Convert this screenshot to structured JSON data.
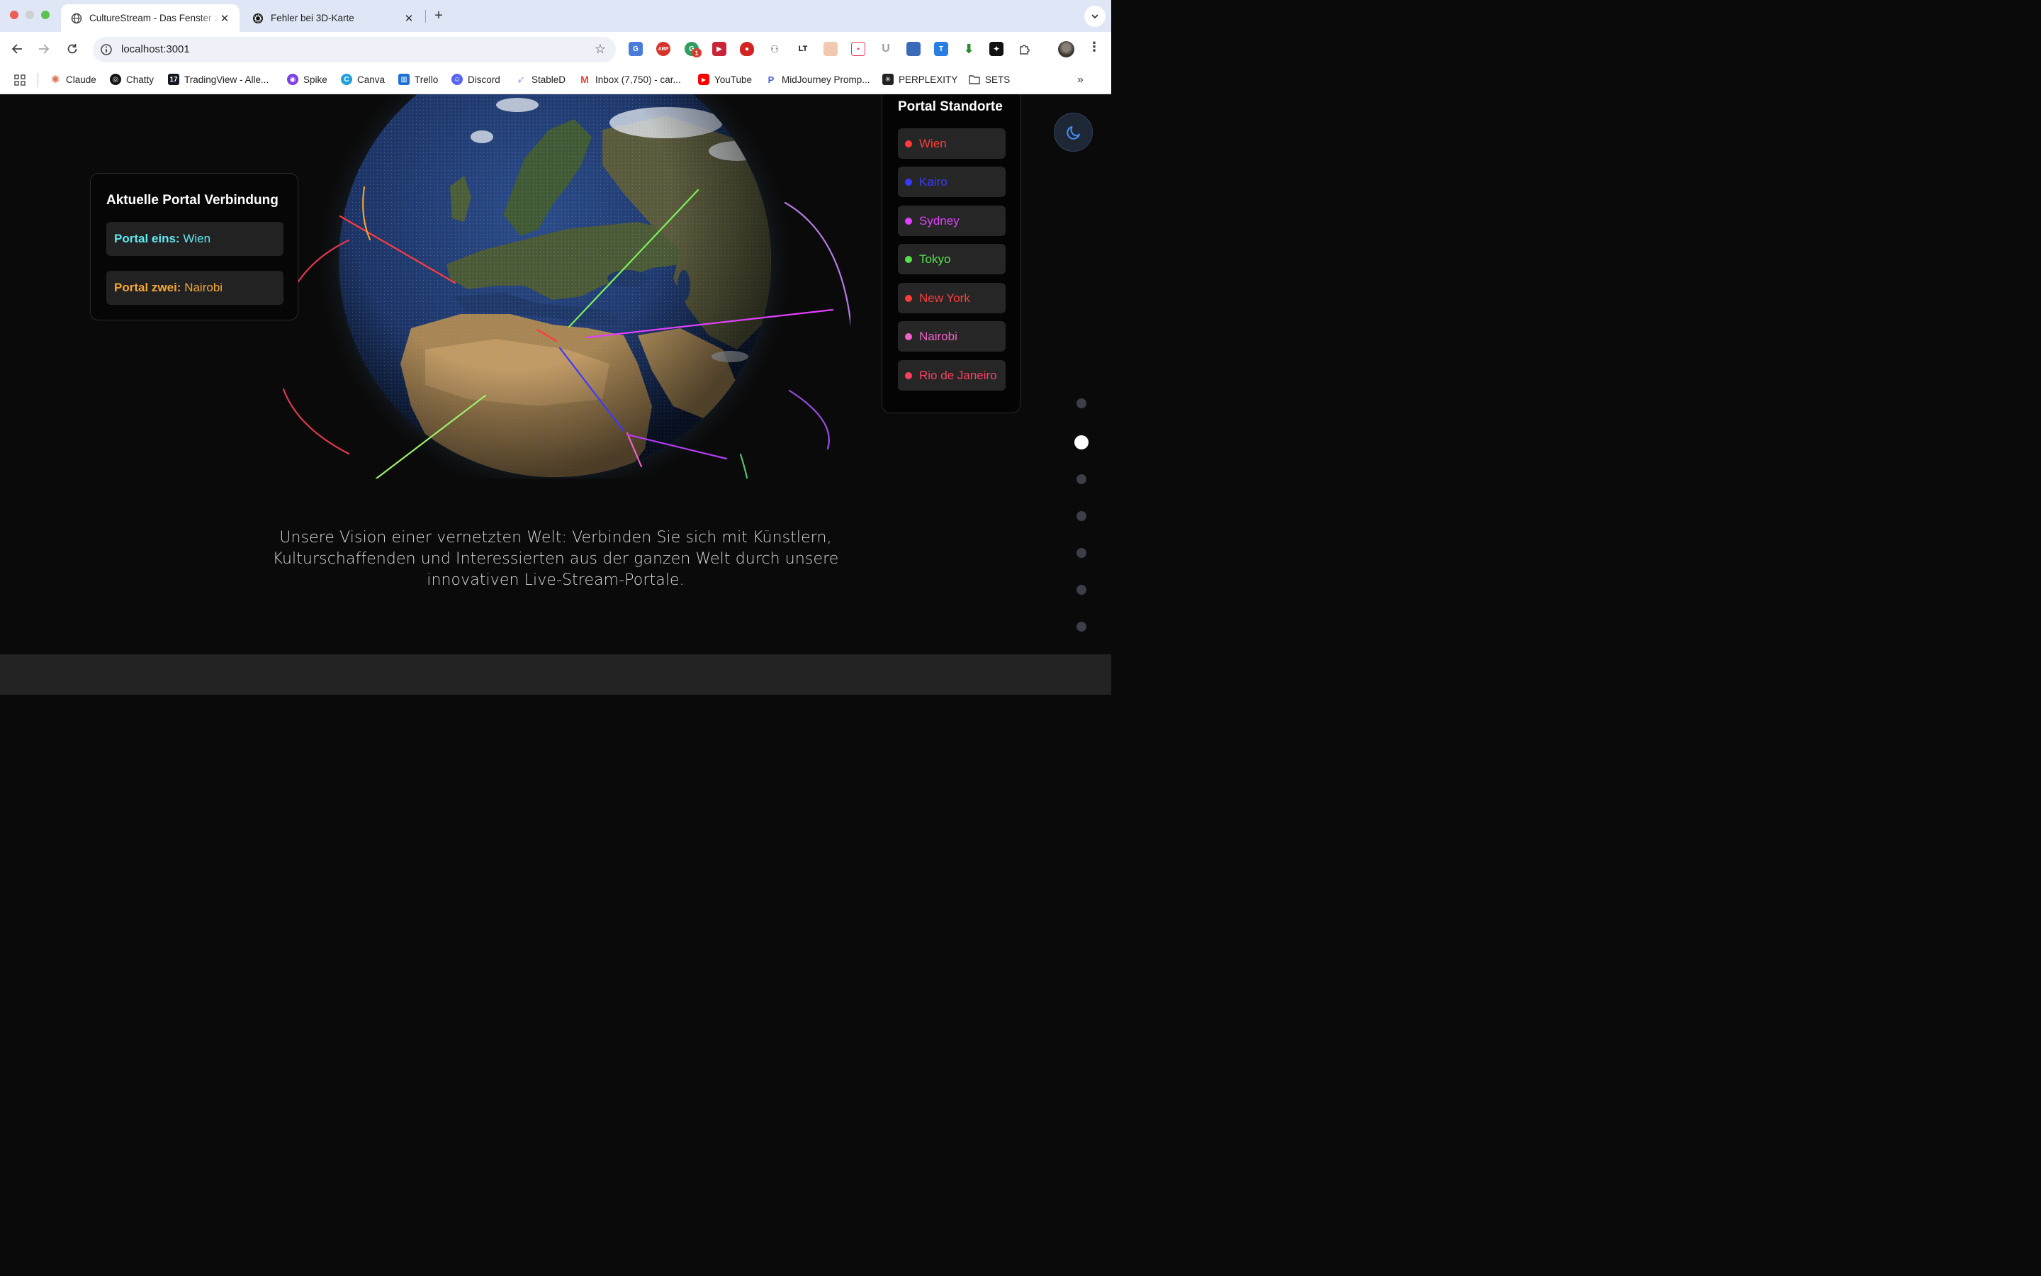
{
  "browser": {
    "tabs": [
      {
        "title": "CultureStream - Das Fenster zur Welt",
        "active": true,
        "favicon": "globe-icon"
      },
      {
        "title": "Fehler bei 3D-Karte",
        "active": false,
        "favicon": "openai-icon"
      }
    ],
    "url": "localhost:3001",
    "extensions": [
      "google-translate-icon",
      "adblock-icon",
      "grammarly-icon",
      "readwise-icon",
      "ublock-icon",
      "cycle-icon",
      "languagetool-icon",
      "screenshot-icon",
      "chat-icon",
      "u-icon",
      "stack-icon",
      "translate-t-icon",
      "download-arrow-icon",
      "sparkle-icon",
      "puzzle-icon"
    ],
    "extension_badge": "1",
    "bookmarks": [
      {
        "label": "Claude",
        "icon": "claude-icon",
        "color": "#d97757"
      },
      {
        "label": "Chatty",
        "icon": "openai-icon",
        "color": "#111111"
      },
      {
        "label": "TradingView - Alle...",
        "icon": "tradingview-icon",
        "color": "#131722"
      },
      {
        "label": "Spike",
        "icon": "spike-icon",
        "color": "#7b3fe4"
      },
      {
        "label": "Canva",
        "icon": "canva-icon",
        "color": "#20a0d8"
      },
      {
        "label": "Trello",
        "icon": "trello-icon",
        "color": "#1d71d6"
      },
      {
        "label": "Discord",
        "icon": "discord-icon",
        "color": "#5865f2"
      },
      {
        "label": "StableD",
        "icon": "rocket-icon",
        "color": "#b38ee0"
      },
      {
        "label": "Inbox (7,750) - car...",
        "icon": "gmail-icon",
        "color": "#ea4335"
      },
      {
        "label": "YouTube",
        "icon": "youtube-icon",
        "color": "#ff0000"
      },
      {
        "label": "MidJourney Promp...",
        "icon": "p-icon",
        "color": "#4c5bd4"
      },
      {
        "label": "PERPLEXITY",
        "icon": "perplexity-icon",
        "color": "#222222"
      },
      {
        "label": "SETS",
        "icon": "folder-icon",
        "color": "#555555"
      }
    ]
  },
  "connection": {
    "title": "Aktuelle Portal Verbindung",
    "portal_one_label": "Portal eins:",
    "portal_one_value": "Wien",
    "portal_two_label": "Portal zwei:",
    "portal_two_value": "Nairobi"
  },
  "locations": {
    "title": "Portal Standorte",
    "items": [
      {
        "name": "Wien",
        "color": "#ff3b3b"
      },
      {
        "name": "Kairo",
        "color": "#3a3aff"
      },
      {
        "name": "Sydney",
        "color": "#e040fb"
      },
      {
        "name": "Tokyo",
        "color": "#58e14a"
      },
      {
        "name": "New York",
        "color": "#ff3b3b"
      },
      {
        "name": "Nairobi",
        "color": "#f062c8"
      },
      {
        "name": "Rio de Janeiro",
        "color": "#ff3f5e"
      }
    ]
  },
  "theme_toggle": {
    "icon": "moon-icon",
    "color": "#4a90f5"
  },
  "section_nav": {
    "count": 8,
    "active_index": 1
  },
  "vision_text": "Unsere Vision einer vernetzten Welt: Verbinden Sie sich mit Künstlern, Kulturschaffenden und Interessierten aus der ganzen Welt durch unsere innovativen Live-Stream-Portale."
}
